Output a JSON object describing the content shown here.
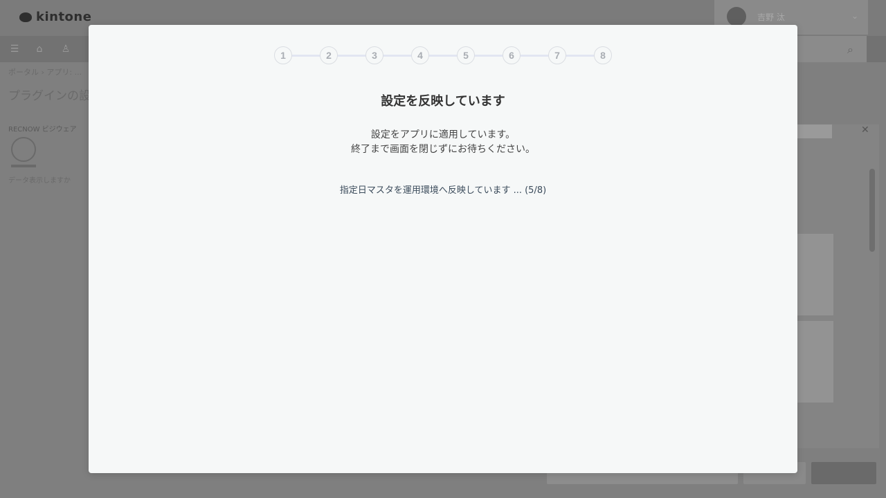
{
  "background_app": {
    "logo_text": "kintone",
    "user_name": "吉野 汰",
    "breadcrumb": "ポータル › アプリ: ...",
    "page_title": "プラグインの設定",
    "section_label": "RECNOW ビジウェア",
    "note": "データ表示しますか"
  },
  "modal": {
    "steps": [
      "1",
      "2",
      "3",
      "4",
      "5",
      "6",
      "7",
      "8"
    ],
    "current_step": 5,
    "total_steps": 8,
    "title": "設定を反映しています",
    "message_line1": "設定をアプリに適用しています。",
    "message_line2": "終了まで画面を閉じずにお待ちください。",
    "progress_text": "指定日マスタを運用環境へ反映しています ... (5/8)"
  },
  "colors": {
    "overlay_bg": "#7f7f7f",
    "modal_bg": "#f6f8f8",
    "step_line": "#e2e6f2",
    "step_border": "#dadde2",
    "step_text": "#a9adb3"
  }
}
